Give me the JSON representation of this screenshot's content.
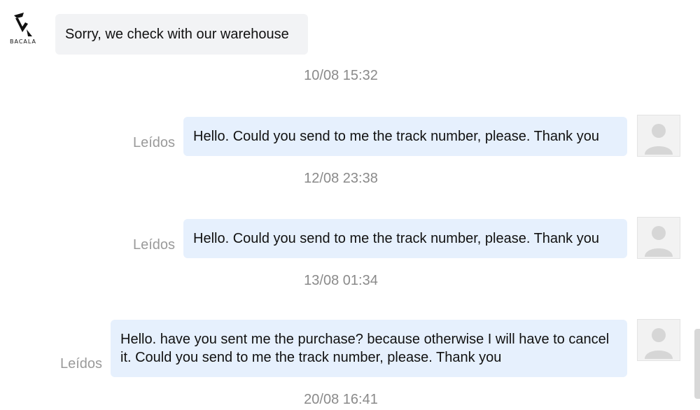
{
  "seller": {
    "logo_text": "BACALA",
    "icon": "seller-logo-icon"
  },
  "messages": [
    {
      "direction": "in",
      "text": "Sorry, we check with our warehouse"
    },
    {
      "direction": "out",
      "timestamp": "10/08 15:32",
      "status": "Leídos",
      "text": "Hello. Could you send to me the track number, please. Thank you"
    },
    {
      "direction": "out",
      "timestamp": "12/08 23:38",
      "status": "Leídos",
      "text": "Hello. Could you send to me the track number, please. Thank you"
    },
    {
      "direction": "out",
      "timestamp": "13/08 01:34",
      "status": "Leídos",
      "text": "Hello. have you sent me the purchase? because otherwise I will have to cancel it. Could you send to me the track number, please. Thank you"
    }
  ],
  "last_timestamp": "20/08 16:41",
  "user": {
    "avatar_icon": "user-avatar-icon"
  },
  "colors": {
    "incoming_bubble": "#f2f3f5",
    "outgoing_bubble": "#e6f0fd",
    "timestamp_text": "#8a8a8a",
    "status_text": "#9a9a9a"
  }
}
